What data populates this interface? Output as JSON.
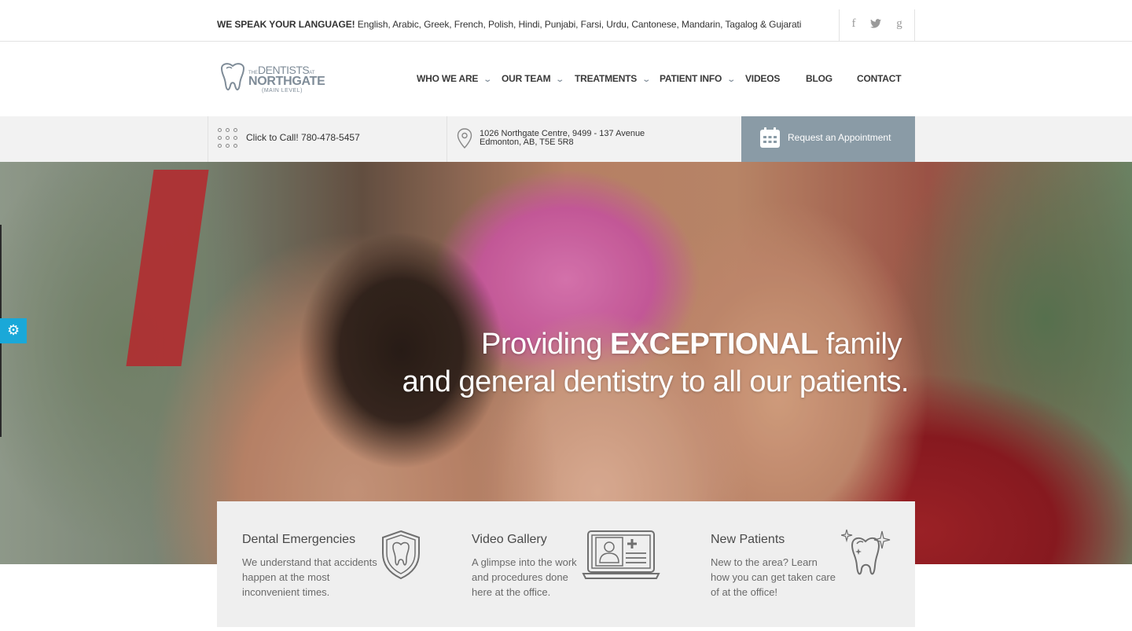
{
  "topbar": {
    "lang_bold": "WE SPEAK YOUR LANGUAGE!",
    "lang_list": " English, Arabic, Greek, French, Polish, Hindi, Punjabi, Farsi, Urdu, Cantonese, Mandarin, Tagalog & Gujarati",
    "social": {
      "facebook": "f",
      "twitter": "🐦",
      "googleplus": "g"
    }
  },
  "logo": {
    "the": "THE",
    "dentists": "DENTISTS",
    "at": "AT",
    "northgate": "NORTHGATE",
    "level": "(MAIN LEVEL)"
  },
  "nav": {
    "items": [
      {
        "label": "WHO WE ARE",
        "dropdown": true
      },
      {
        "label": "OUR TEAM",
        "dropdown": true
      },
      {
        "label": "TREATMENTS",
        "dropdown": true
      },
      {
        "label": "PATIENT INFO",
        "dropdown": true
      },
      {
        "label": "VIDEOS",
        "dropdown": false
      },
      {
        "label": "BLOG",
        "dropdown": false
      },
      {
        "label": "CONTACT",
        "dropdown": false
      }
    ],
    "chevron": "⌄"
  },
  "infobar": {
    "call": "Click to Call! 780-478-5457",
    "address_line1": "1026 Northgate Centre, 9499 - 137 Avenue",
    "address_line2": "Edmonton, AB, T5E 5R8",
    "appointment": "Request an Appointment"
  },
  "hero": {
    "line1_pre": "Providing ",
    "line1_bold": "EXCEPTIONAL",
    "line1_post": " family",
    "line2": "and general dentistry to all our patients."
  },
  "gear_icon": "⚙",
  "features": [
    {
      "title": "Dental Emergencies",
      "desc": "We understand that accidents happen at the most inconvenient times.",
      "icon": "tooth-shield-icon"
    },
    {
      "title": "Video Gallery",
      "desc": "A glimpse into the work and procedures done here at the office.",
      "icon": "laptop-profile-icon"
    },
    {
      "title": "New Patients",
      "desc": "New to the area? Learn how you can get taken care of at the office!",
      "icon": "sparkling-tooth-icon"
    }
  ],
  "colors": {
    "accent": "#8a9ba6",
    "gear_tab": "#1aa8d8",
    "logo": "#7f8c98",
    "feature_bg": "#efefef"
  }
}
